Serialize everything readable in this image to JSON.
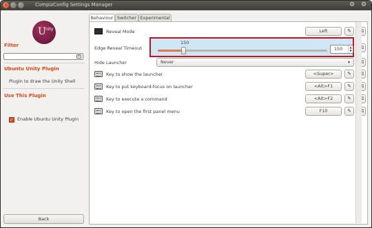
{
  "window": {
    "title": "CompizConfig Settings Manager",
    "close_glyph": "×",
    "min_glyph": "",
    "max_glyph": "",
    "gear_glyph": "⚙",
    "accent_color": "#dd4814",
    "highlight_color": "#c4121b"
  },
  "sidebar": {
    "logo_text": "U",
    "logo_sup": "nity",
    "filter_heading": "Filter",
    "filter_value": "",
    "filter_clear_glyph": "×",
    "plugin_heading": "Ubuntu Unity Plugin",
    "plugin_description": "Plugin to draw the Unity Shell",
    "use_heading": "Use This Plugin",
    "enable_label": "Enable Ubuntu Unity Plugin",
    "enable_checked": true,
    "enable_glyph": "✓",
    "back_label": "Back"
  },
  "tabs": [
    {
      "label": "Behaviour",
      "active": true
    },
    {
      "label": "Switcher",
      "active": false
    },
    {
      "label": "Experimental",
      "active": false
    }
  ],
  "settings": {
    "reveal_mode": {
      "label": "Reveal Mode",
      "value": "Left",
      "icon": "monitor-icon"
    },
    "edge_reveal": {
      "label": "Edge Reveal Timeout",
      "value": "150",
      "slider_label": "150",
      "slider_min": 0,
      "slider_max": 1000,
      "slider_level": 150
    },
    "hide_launcher": {
      "label": "Hide Launcher",
      "value": "Never",
      "arrow": "▾"
    },
    "show_launcher": {
      "label": "Key to show the launcher",
      "value": "<Super>",
      "icon": "keyboard-icon"
    },
    "keyboard_focus": {
      "label": "Key to put keyboard-focus on launcher",
      "value": "<Alt>F1",
      "icon": "keyboard-icon"
    },
    "execute_command": {
      "label": "Key to execute a command",
      "value": "<Alt>F2",
      "icon": "keyboard-icon"
    },
    "panel_menu": {
      "label": "Key to open the first panel menu",
      "value": "F10",
      "icon": "keyboard-icon"
    }
  },
  "glyphs": {
    "edit": "✎",
    "clear": "⌫",
    "spin_up": "▲",
    "spin_down": "▼"
  }
}
